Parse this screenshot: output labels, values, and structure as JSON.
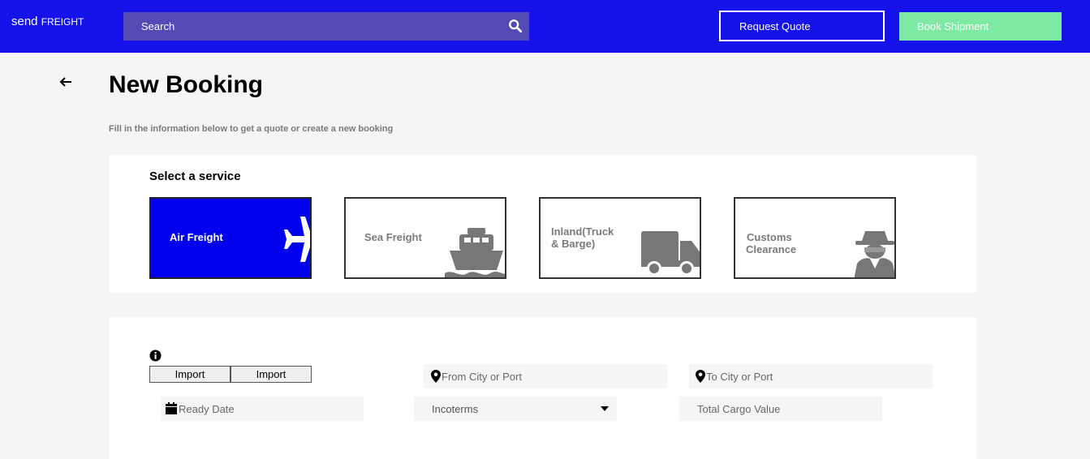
{
  "header": {
    "logo_part1": "send",
    "logo_part2": "FREIGHT",
    "search_placeholder": "Search",
    "request_quote_label": "Request Quote",
    "book_shipment_label": "Book Shipment",
    "brand_color": "#1512ea",
    "book_color": "#7de9a2"
  },
  "page": {
    "title": "New Booking",
    "subtitle": "Fill in the information below to get a quote or create a new booking"
  },
  "services": {
    "label": "Select a service",
    "items": [
      {
        "line1": "Air Freight",
        "line2": "",
        "icon": "airplane-icon",
        "active": true
      },
      {
        "line1": "Sea Freight",
        "line2": "",
        "icon": "ship-icon",
        "active": false
      },
      {
        "line1": "Inland(Truck",
        "line2": " & Barge)",
        "icon": "truck-icon",
        "active": false
      },
      {
        "line1": "Customs",
        "line2": "Clearance",
        "icon": "agent-icon",
        "active": false
      }
    ],
    "active_color": "#0000ee"
  },
  "form": {
    "import_button_1": "Import",
    "import_button_2": "Import",
    "from_placeholder": "From City or Port",
    "to_placeholder": "To City or Port",
    "ready_date_placeholder": "Ready Date",
    "incoterms_value": "Incoterms",
    "cargo_value_placeholder": "Total Cargo Value"
  }
}
